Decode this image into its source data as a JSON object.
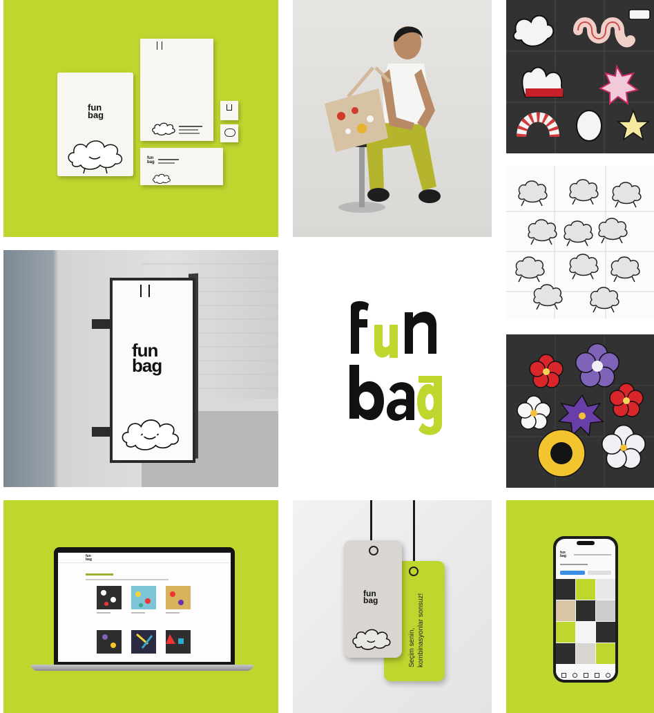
{
  "brand": {
    "logo_line1": "fun",
    "logo_line2": "bag",
    "colors": {
      "lime": "#bfd62f",
      "dark": "#323232",
      "black": "#111111"
    }
  },
  "hang_tag": {
    "text_line1": "Seçim senin,",
    "text_line2": "kombinasyonlar sonsuz!"
  },
  "tiles": [
    {
      "name": "stationery-mockup"
    },
    {
      "name": "model-with-tote-photo"
    },
    {
      "name": "sticker-sheet-dark"
    },
    {
      "name": "cloud-character-sheet"
    },
    {
      "name": "lightbox-sign-mockup"
    },
    {
      "name": "logo-center"
    },
    {
      "name": "flower-sticker-sheet"
    },
    {
      "name": "laptop-website-mockup"
    },
    {
      "name": "hang-tag-mockup"
    },
    {
      "name": "phone-instagram-mockup"
    }
  ]
}
